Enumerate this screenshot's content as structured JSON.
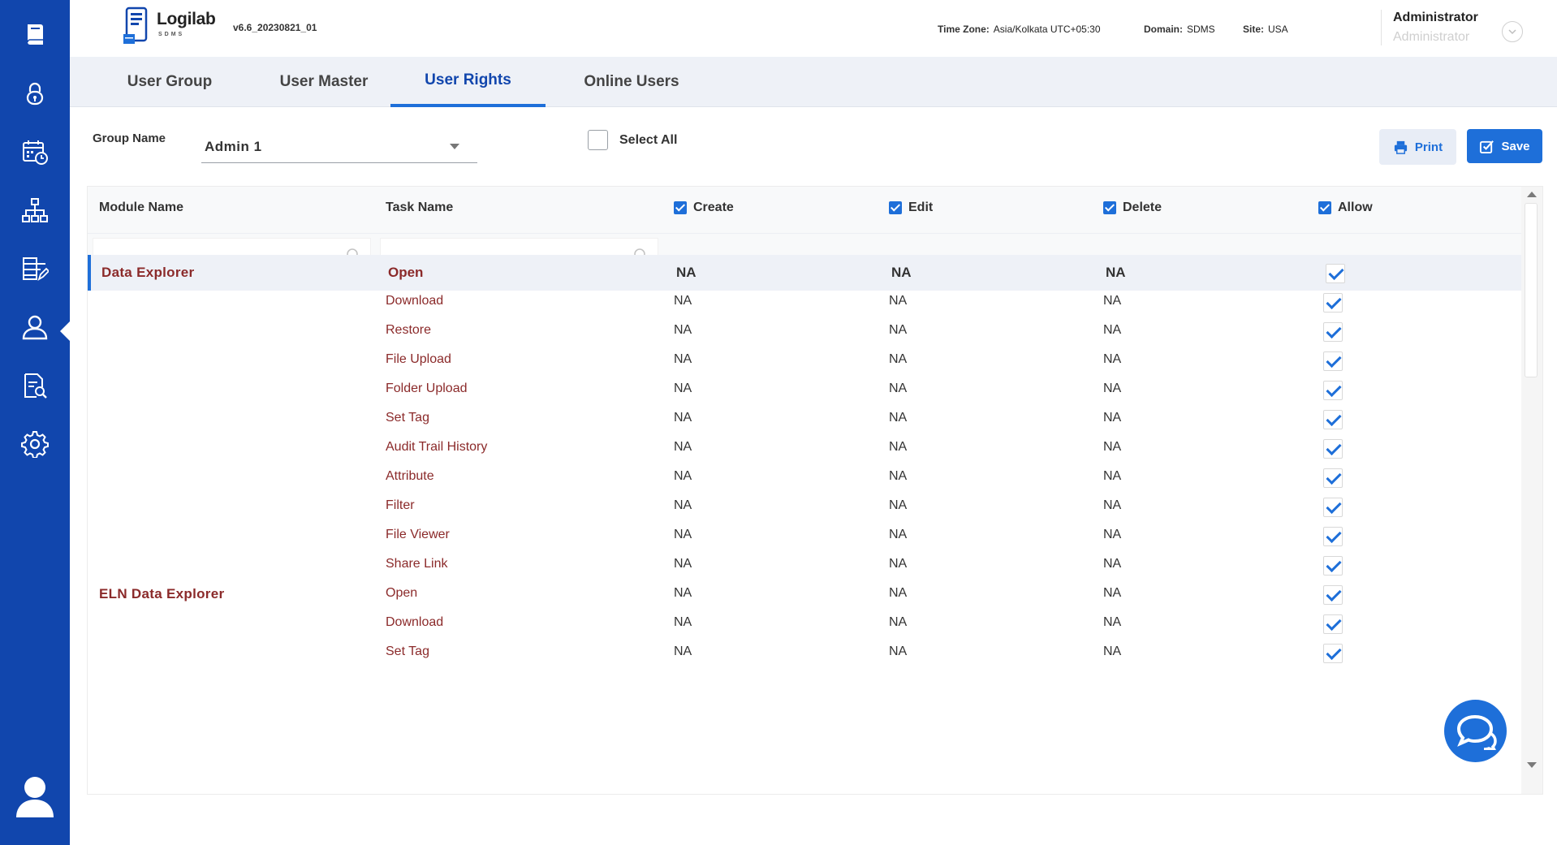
{
  "app": {
    "logo_text": "Logilab",
    "logo_sub": "SDMS",
    "version": "v6.6_20230821_01"
  },
  "header": {
    "timezone_label": "Time Zone:",
    "timezone_value": "Asia/Kolkata UTC+05:30",
    "domain_label": "Domain:",
    "domain_value": "SDMS",
    "site_label": "Site:",
    "site_value": "USA",
    "user_name": "Administrator",
    "user_role": "Administrator"
  },
  "sidebar": {
    "items": [
      {
        "icon": "book-icon"
      },
      {
        "icon": "lock-icon"
      },
      {
        "icon": "calendar-clock-icon"
      },
      {
        "icon": "org-chart-icon"
      },
      {
        "icon": "server-edit-icon"
      },
      {
        "icon": "user-icon",
        "active": true
      },
      {
        "icon": "document-search-icon"
      },
      {
        "icon": "gear-icon"
      }
    ]
  },
  "tabs": [
    {
      "label": "User Group"
    },
    {
      "label": "User Master"
    },
    {
      "label": "User Rights",
      "active": true
    },
    {
      "label": "Online Users"
    }
  ],
  "filters": {
    "group_label": "Group Name",
    "group_value": "Admin 1",
    "select_all_label": "Select All",
    "print_label": "Print",
    "save_label": "Save"
  },
  "table": {
    "columns": {
      "module": "Module Name",
      "task": "Task Name",
      "create": "Create",
      "edit": "Edit",
      "delete": "Delete",
      "allow": "Allow"
    },
    "rows": [
      {
        "module": "Data Explorer",
        "task": "Open",
        "create": "NA",
        "edit": "NA",
        "delete": "NA",
        "allow": true,
        "selected": true
      },
      {
        "module": "",
        "task": "Download",
        "create": "NA",
        "edit": "NA",
        "delete": "NA",
        "allow": true
      },
      {
        "module": "",
        "task": "Restore",
        "create": "NA",
        "edit": "NA",
        "delete": "NA",
        "allow": true
      },
      {
        "module": "",
        "task": "File Upload",
        "create": "NA",
        "edit": "NA",
        "delete": "NA",
        "allow": true
      },
      {
        "module": "",
        "task": "Folder Upload",
        "create": "NA",
        "edit": "NA",
        "delete": "NA",
        "allow": true
      },
      {
        "module": "",
        "task": "Set Tag",
        "create": "NA",
        "edit": "NA",
        "delete": "NA",
        "allow": true
      },
      {
        "module": "",
        "task": "Audit Trail History",
        "create": "NA",
        "edit": "NA",
        "delete": "NA",
        "allow": true
      },
      {
        "module": "",
        "task": "Attribute",
        "create": "NA",
        "edit": "NA",
        "delete": "NA",
        "allow": true
      },
      {
        "module": "",
        "task": "Filter",
        "create": "NA",
        "edit": "NA",
        "delete": "NA",
        "allow": true
      },
      {
        "module": "",
        "task": "File Viewer",
        "create": "NA",
        "edit": "NA",
        "delete": "NA",
        "allow": true
      },
      {
        "module": "",
        "task": "Share Link",
        "create": "NA",
        "edit": "NA",
        "delete": "NA",
        "allow": true
      },
      {
        "module": "ELN Data Explorer",
        "task": "Open",
        "create": "NA",
        "edit": "NA",
        "delete": "NA",
        "allow": true
      },
      {
        "module": "",
        "task": "Download",
        "create": "NA",
        "edit": "NA",
        "delete": "NA",
        "allow": true
      },
      {
        "module": "",
        "task": "Set Tag",
        "create": "NA",
        "edit": "NA",
        "delete": "NA",
        "allow": true
      }
    ]
  },
  "colors": {
    "sidebar": "#1146ad",
    "accent": "#1e6fd9",
    "module_text": "#8b2a2a"
  }
}
